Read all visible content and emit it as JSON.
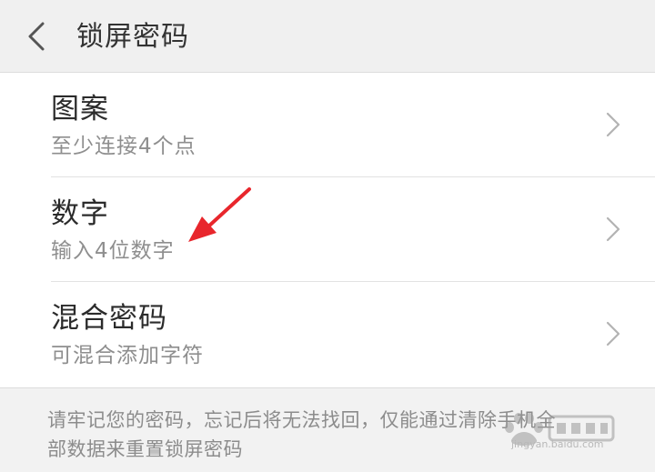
{
  "header": {
    "title": "锁屏密码",
    "back_icon": "chevron-left-icon"
  },
  "options": [
    {
      "title": "图案",
      "subtitle": "至少连接4个点",
      "icon": "chevron-right-icon"
    },
    {
      "title": "数字",
      "subtitle": "输入4位数字",
      "icon": "chevron-right-icon"
    },
    {
      "title": "混合密码",
      "subtitle": "可混合添加字符",
      "icon": "chevron-right-icon"
    }
  ],
  "note": {
    "line1": "请牢记您的密码，忘记后将无法找回，仅能通过清除手机全",
    "line2": "部数据来重置锁屏密码"
  },
  "annotation": {
    "color": "#e8262c"
  },
  "watermark": {
    "text": "jingyan.baidu.com",
    "logo": "baidu-paw-logo"
  },
  "colors": {
    "background": "#f2f2f2",
    "card": "#ffffff",
    "title_text": "#2b2b2b",
    "subtitle_text": "#8e8e8e"
  }
}
